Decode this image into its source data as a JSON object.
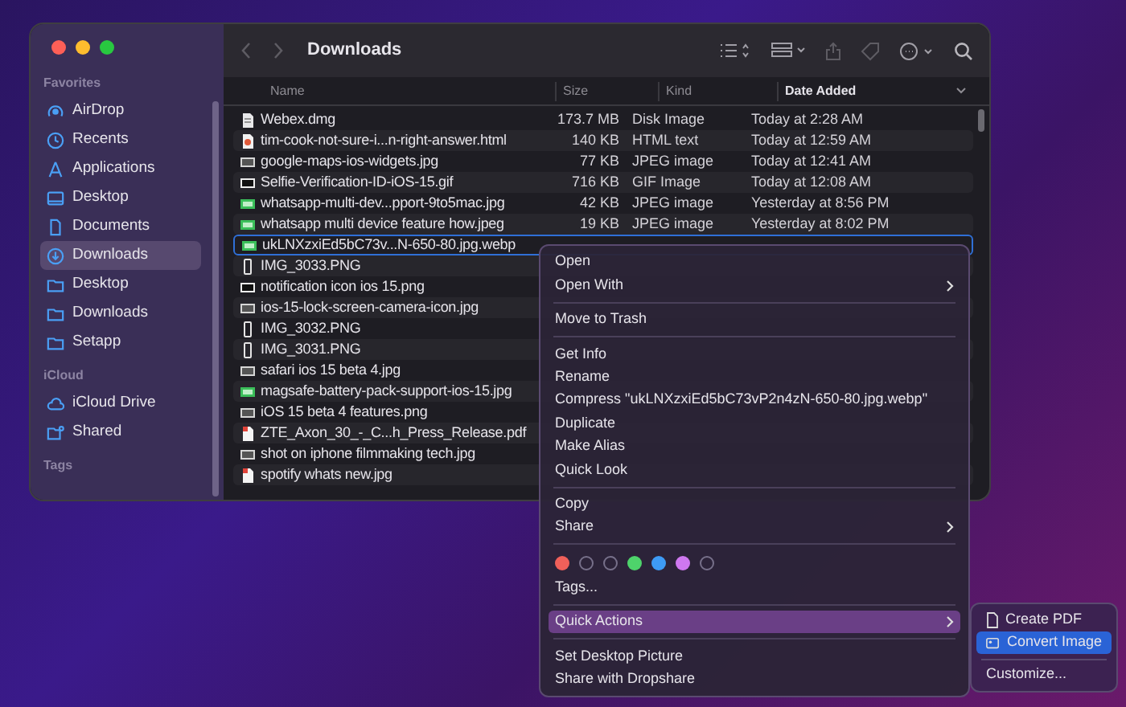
{
  "window": {
    "title": "Downloads"
  },
  "sidebar": {
    "sections": [
      {
        "heading": "Favorites",
        "items": [
          {
            "label": "AirDrop",
            "selected": false
          },
          {
            "label": "Recents",
            "selected": false
          },
          {
            "label": "Applications",
            "selected": false
          },
          {
            "label": "Desktop",
            "selected": false
          },
          {
            "label": "Documents",
            "selected": false
          },
          {
            "label": "Downloads",
            "selected": true
          },
          {
            "label": "Desktop",
            "selected": false
          },
          {
            "label": "Downloads",
            "selected": false
          },
          {
            "label": "Setapp",
            "selected": false
          }
        ]
      },
      {
        "heading": "iCloud",
        "items": [
          {
            "label": "iCloud Drive",
            "selected": false
          },
          {
            "label": "Shared",
            "selected": false
          }
        ]
      },
      {
        "heading": "Tags"
      }
    ]
  },
  "table": {
    "columns": [
      {
        "label": "Name",
        "sorted": false
      },
      {
        "label": "Size",
        "sorted": false
      },
      {
        "label": "Kind",
        "sorted": false
      },
      {
        "label": "Date Added",
        "sorted": true
      }
    ],
    "rows": [
      {
        "name": "Webex.dmg",
        "kind": "document",
        "size": "173.7 MB",
        "file_type": "Disk Image",
        "date": "Today at 2:28 AM",
        "selected": false
      },
      {
        "name": "tim-cook-not-sure-i...n-right-answer.html",
        "kind": "web",
        "size": "140 KB",
        "file_type": "HTML text",
        "date": "Today at 12:59 AM",
        "selected": false
      },
      {
        "name": "google-maps-ios-widgets.jpg",
        "kind": "image",
        "size": "77 KB",
        "file_type": "JPEG image",
        "date": "Today at 12:41 AM",
        "selected": false
      },
      {
        "name": "Selfie-Verification-ID-iOS-15.gif",
        "kind": "dark",
        "size": "716 KB",
        "file_type": "GIF Image",
        "date": "Today at 12:08 AM",
        "selected": false
      },
      {
        "name": "whatsapp-multi-dev...pport-9to5mac.jpg",
        "kind": "green",
        "size": "42 KB",
        "file_type": "JPEG image",
        "date": "Yesterday at 8:56 PM",
        "selected": false
      },
      {
        "name": "whatsapp multi device feature how.jpeg",
        "kind": "green",
        "size": "19 KB",
        "file_type": "JPEG image",
        "date": "Yesterday at 8:02 PM",
        "selected": false
      },
      {
        "name": "ukLNXzxiEd5bC73v...N-650-80.jpg.webp",
        "kind": "green",
        "selected": true
      },
      {
        "name": "IMG_3033.PNG",
        "kind": "phone",
        "selected": false
      },
      {
        "name": "notification icon ios 15.png",
        "kind": "dark",
        "selected": false
      },
      {
        "name": "ios-15-lock-screen-camera-icon.jpg",
        "kind": "image",
        "selected": false
      },
      {
        "name": "IMG_3032.PNG",
        "kind": "phone",
        "selected": false
      },
      {
        "name": "IMG_3031.PNG",
        "kind": "phone",
        "selected": false
      },
      {
        "name": "safari ios 15 beta 4.jpg",
        "kind": "image",
        "selected": false
      },
      {
        "name": "magsafe-battery-pack-support-ios-15.jpg",
        "kind": "green",
        "selected": false
      },
      {
        "name": "iOS 15 beta 4 features.png",
        "kind": "image",
        "selected": false
      },
      {
        "name": "ZTE_Axon_30_-_C...h_Press_Release.pdf",
        "kind": "pdf",
        "selected": false
      },
      {
        "name": "shot on iphone filmmaking tech.jpg",
        "kind": "image",
        "selected": false
      },
      {
        "name": "spotify whats new.jpg",
        "kind": "pdf",
        "selected": false
      }
    ]
  },
  "context_menu": {
    "items": [
      {
        "kind": "item",
        "label": "Open",
        "submenu": false,
        "selected": false
      },
      {
        "kind": "item",
        "label": "Open With",
        "submenu": true,
        "selected": false
      },
      {
        "kind": "separator"
      },
      {
        "kind": "item",
        "label": "Move to Trash",
        "submenu": false,
        "selected": false
      },
      {
        "kind": "separator"
      },
      {
        "kind": "item",
        "label": "Get Info",
        "submenu": false,
        "selected": false
      },
      {
        "kind": "item",
        "label": "Rename",
        "submenu": false,
        "selected": false
      },
      {
        "kind": "item",
        "label": "Compress \"ukLNXzxiEd5bC73vP2n4zN-650-80.jpg.webp\"",
        "submenu": false,
        "selected": false
      },
      {
        "kind": "item",
        "label": "Duplicate",
        "submenu": false,
        "selected": false
      },
      {
        "kind": "item",
        "label": "Make Alias",
        "submenu": false,
        "selected": false
      },
      {
        "kind": "item",
        "label": "Quick Look",
        "submenu": false,
        "selected": false
      },
      {
        "kind": "separator"
      },
      {
        "kind": "item",
        "label": "Copy",
        "submenu": false,
        "selected": false
      },
      {
        "kind": "item",
        "label": "Share",
        "submenu": true,
        "selected": false
      },
      {
        "kind": "separator"
      },
      {
        "kind": "tags",
        "tags": [
          {
            "filled": true,
            "color": "#f0605a"
          },
          {
            "filled": false
          },
          {
            "filled": false
          },
          {
            "filled": true,
            "color": "#4ed36b"
          },
          {
            "filled": true,
            "color": "#3e9bf5"
          },
          {
            "filled": true,
            "color": "#cf78f0"
          },
          {
            "filled": false
          }
        ]
      },
      {
        "kind": "item",
        "label": "Tags...",
        "submenu": false,
        "selected": false
      },
      {
        "kind": "separator"
      },
      {
        "kind": "item",
        "label": "Quick Actions",
        "submenu": true,
        "selected": true
      },
      {
        "kind": "separator"
      },
      {
        "kind": "item",
        "label": "Set Desktop Picture",
        "submenu": false,
        "selected": false
      },
      {
        "kind": "item",
        "label": "Share with Dropshare",
        "submenu": false,
        "selected": false
      }
    ]
  },
  "submenu": {
    "items": [
      {
        "kind": "item",
        "label": "Create PDF",
        "selected": false
      },
      {
        "kind": "item",
        "label": "Convert Image",
        "selected": true
      },
      {
        "kind": "separator"
      },
      {
        "kind": "item",
        "label": "Customize...",
        "selected": false
      }
    ]
  }
}
